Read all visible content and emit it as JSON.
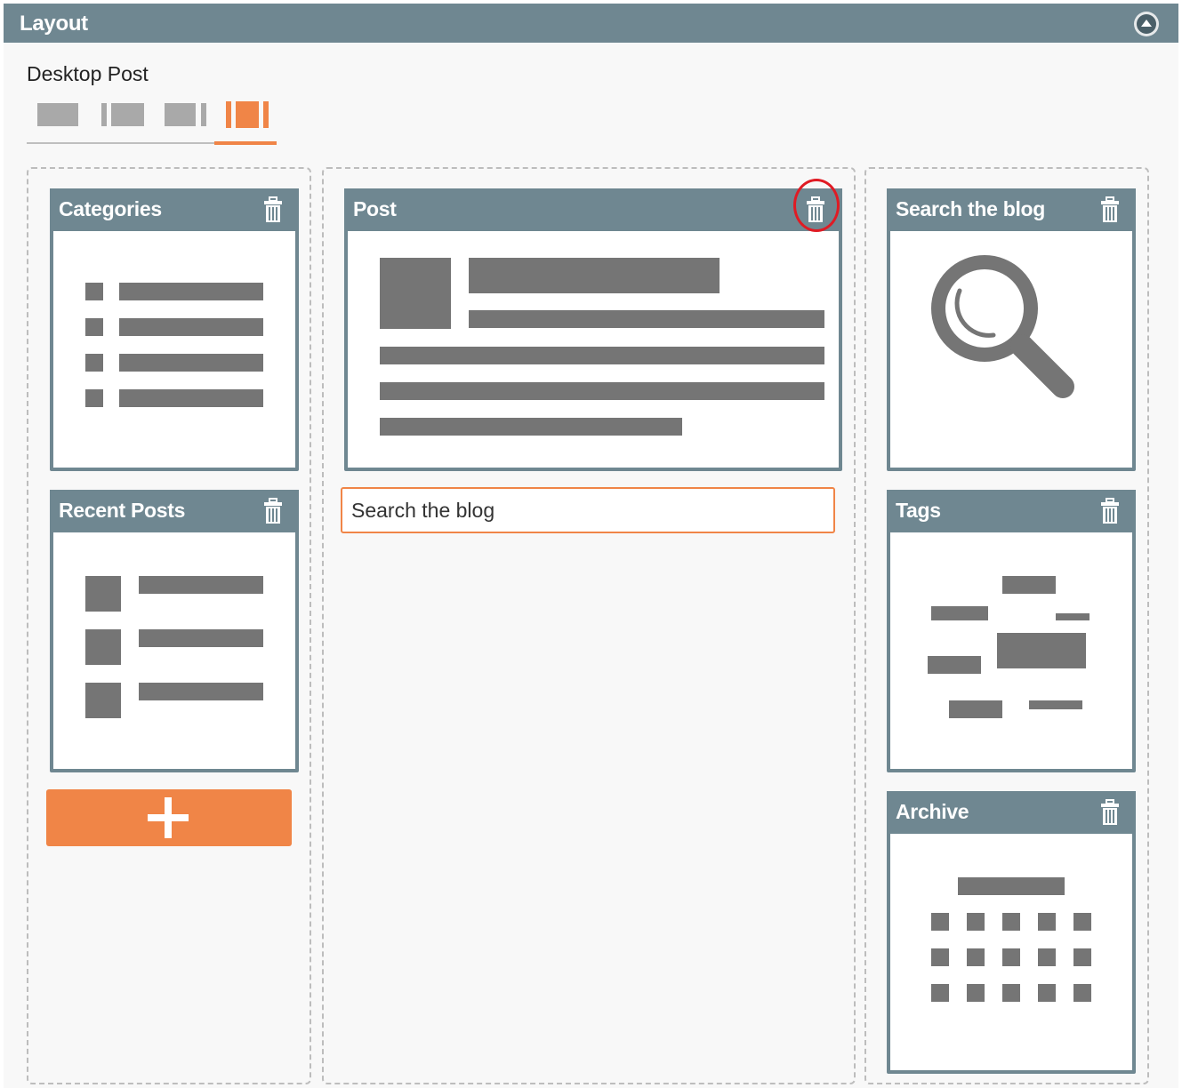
{
  "panel": {
    "title": "Layout",
    "collapse_icon": "chevron-up-circle-icon"
  },
  "layout_selector": {
    "label": "Desktop Post",
    "options": [
      {
        "icon": "layout-full-width-icon",
        "selected": false
      },
      {
        "icon": "layout-left-sidebar-icon",
        "selected": false
      },
      {
        "icon": "layout-right-sidebar-icon",
        "selected": false
      },
      {
        "icon": "layout-both-sidebars-icon",
        "selected": true
      }
    ]
  },
  "columns": {
    "left": {
      "widgets": [
        {
          "title": "Categories",
          "icon": "categories-list-icon"
        },
        {
          "title": "Recent Posts",
          "icon": "recent-posts-icon"
        }
      ],
      "add_button_icon": "plus-icon"
    },
    "main": {
      "widgets": [
        {
          "title": "Post",
          "icon": "post-content-icon"
        }
      ],
      "search_placeholder": "Search the blog"
    },
    "right": {
      "widgets": [
        {
          "title": "Search the blog",
          "icon": "magnifier-icon"
        },
        {
          "title": "Tags",
          "icon": "tag-cloud-icon"
        },
        {
          "title": "Archive",
          "icon": "calendar-icon"
        }
      ]
    }
  },
  "colors": {
    "header": "#6f8791",
    "accent": "#f08547",
    "placeholder_graphic": "#757575",
    "highlight": "#e01b24"
  }
}
